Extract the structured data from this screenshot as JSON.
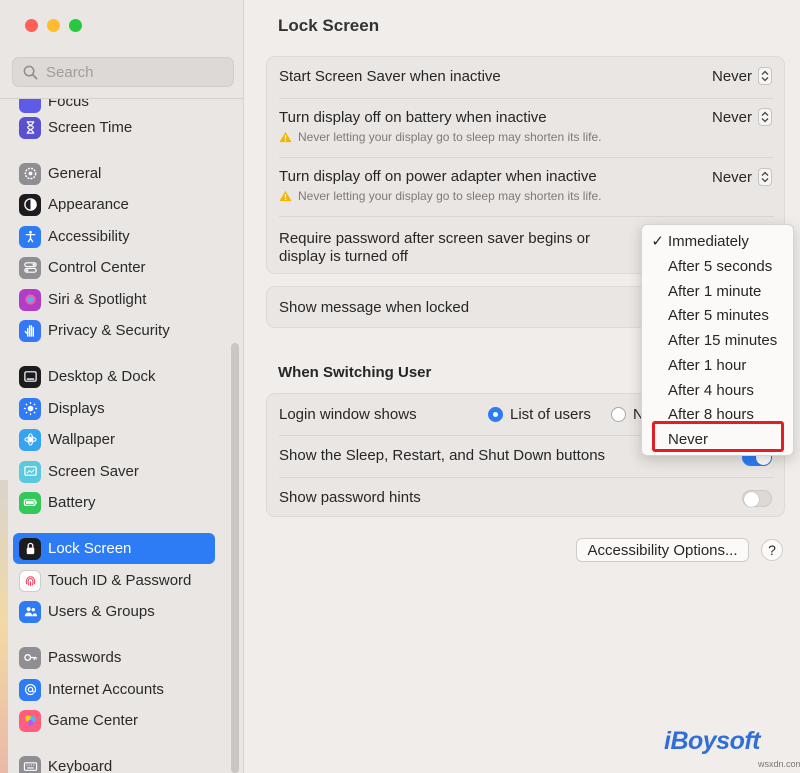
{
  "sidebar": {
    "search_placeholder": "Search",
    "partial_top_label": "Focus",
    "items": [
      {
        "label": "Screen Time",
        "icon": "hourglass-icon",
        "color": "#5a4fcf"
      },
      {
        "label": "General",
        "icon": "gear-icon",
        "color": "#8e8e93"
      },
      {
        "label": "Appearance",
        "icon": "appearance-icon",
        "color": "#1c1c1e"
      },
      {
        "label": "Accessibility",
        "icon": "accessibility-icon",
        "color": "#2d7cf6"
      },
      {
        "label": "Control Center",
        "icon": "control-center-icon",
        "color": "#8e8e93"
      },
      {
        "label": "Siri & Spotlight",
        "icon": "siri-icon",
        "color": "#b13dc6"
      },
      {
        "label": "Privacy & Security",
        "icon": "hand-icon",
        "color": "#3478f6"
      },
      {
        "label": "Desktop & Dock",
        "icon": "dock-icon",
        "color": "#1c1c1e"
      },
      {
        "label": "Displays",
        "icon": "sun-icon",
        "color": "#2d7cf6"
      },
      {
        "label": "Wallpaper",
        "icon": "wallpaper-icon",
        "color": "#35a3f0"
      },
      {
        "label": "Screen Saver",
        "icon": "screen-saver-icon",
        "color": "#5ac8de"
      },
      {
        "label": "Battery",
        "icon": "battery-icon",
        "color": "#34c759"
      },
      {
        "label": "Lock Screen",
        "icon": "lock-icon",
        "color": "#1c1c1e",
        "active": true
      },
      {
        "label": "Touch ID & Password",
        "icon": "fingerprint-icon",
        "color": "#ffffff"
      },
      {
        "label": "Users & Groups",
        "icon": "users-icon",
        "color": "#2d7cf6"
      },
      {
        "label": "Passwords",
        "icon": "key-icon",
        "color": "#8e8e93"
      },
      {
        "label": "Internet Accounts",
        "icon": "at-icon",
        "color": "#2d7cf6"
      },
      {
        "label": "Game Center",
        "icon": "game-center-icon",
        "color": "#ff5e7e"
      },
      {
        "label": "Keyboard",
        "icon": "keyboard-icon",
        "color": "#8e8e93"
      }
    ]
  },
  "main": {
    "title": "Lock Screen",
    "rows": {
      "screen_saver": {
        "label": "Start Screen Saver when inactive",
        "value": "Never"
      },
      "battery": {
        "label": "Turn display off on battery when inactive",
        "value": "Never",
        "warning": "Never letting your display go to sleep may shorten its life."
      },
      "power": {
        "label": "Turn display off on power adapter when inactive",
        "value": "Never",
        "warning": "Never letting your display go to sleep may shorten its life."
      },
      "require_password": {
        "label_line1": "Require password after screen saver begins or",
        "label_line2": "display is turned off"
      },
      "show_message": {
        "label": "Show message when locked"
      }
    },
    "switching_user": {
      "heading": "When Switching User",
      "login_window": {
        "label": "Login window shows",
        "options": [
          "List of users",
          "N"
        ],
        "selected": "List of users"
      },
      "sleep_buttons": {
        "label": "Show the Sleep, Restart, and Shut Down buttons",
        "on": true
      },
      "password_hints": {
        "label": "Show password hints",
        "on": false
      }
    },
    "accessibility_button": "Accessibility Options...",
    "help_button": "?"
  },
  "dropdown": {
    "check": "✓",
    "selected": "Immediately",
    "highlighted": "Never",
    "options": [
      "Immediately",
      "After 5 seconds",
      "After 1 minute",
      "After 5 minutes",
      "After 15 minutes",
      "After 1 hour",
      "After 4 hours",
      "After 8 hours",
      "Never"
    ]
  },
  "watermark": {
    "logo": "iBoysoft",
    "site": "wsxdn.com",
    "color": "#2f6fd6"
  },
  "colors": {
    "accent": "#2d7cf6",
    "highlight_box": "#e01e24"
  }
}
